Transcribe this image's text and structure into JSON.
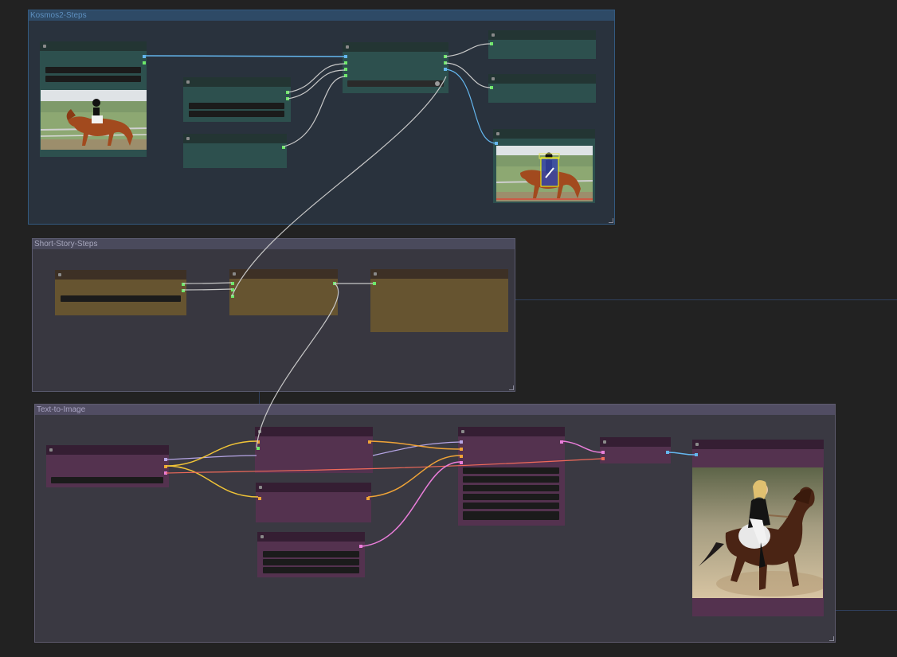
{
  "groups": {
    "kosmos": {
      "title": "Kosmos2-Steps"
    },
    "story": {
      "title": "Short-Story-Steps"
    },
    "t2i": {
      "title": "Text-to-Image"
    }
  },
  "colors": {
    "canvas": "#222222",
    "teal_node": "#2d504e",
    "olive_node": "#665430",
    "purple_node": "#54324f",
    "link_blue": "#64b6ee",
    "link_white": "#c8c8c8",
    "link_yellow": "#f0c437",
    "link_pink": "#ea7eda",
    "link_salmon": "#f06a5a",
    "link_lavender": "#b6a6e6"
  },
  "images": {
    "source": "horse-rider-photo",
    "annotated": "horse-rider-bbox-photo",
    "generated": "generated-rider-on-horse"
  }
}
